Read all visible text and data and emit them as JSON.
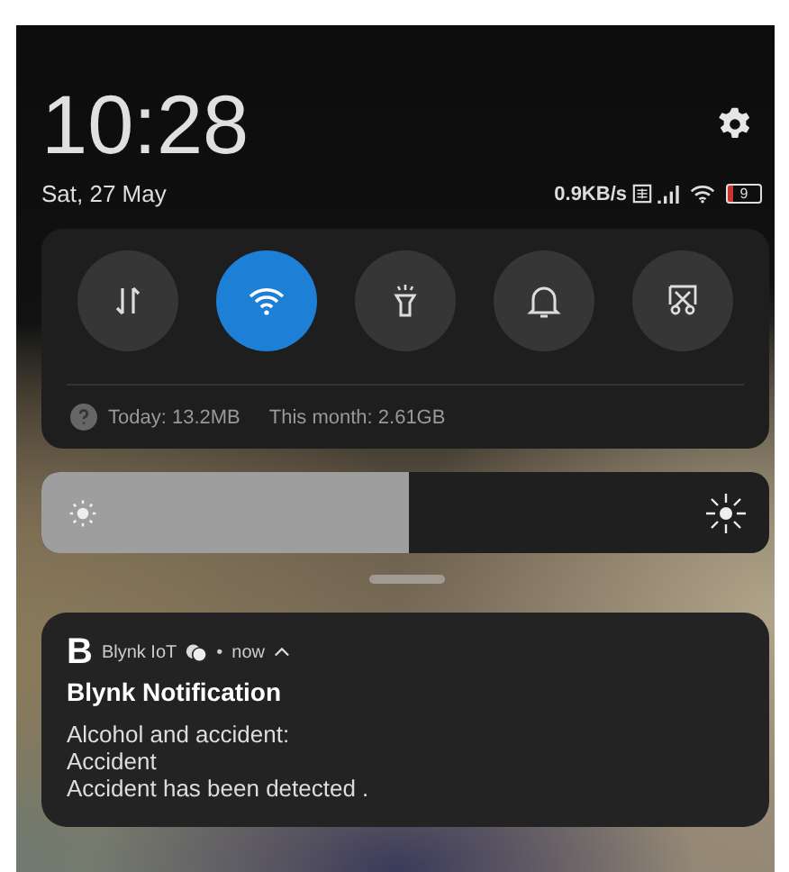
{
  "clock": {
    "time": "10:28",
    "date": "Sat, 27 May"
  },
  "status_bar": {
    "net_speed": "0.9KB/s",
    "battery": "9"
  },
  "toggles": [
    {
      "kind": "data",
      "on": false
    },
    {
      "kind": "wifi",
      "on": true
    },
    {
      "kind": "flashlight",
      "on": false
    },
    {
      "kind": "sound",
      "on": false
    },
    {
      "kind": "screenshot",
      "on": false
    }
  ],
  "data_usage": {
    "today": "Today: 13.2MB",
    "month": "This month: 2.61GB"
  },
  "brightness": {
    "level": 0.505
  },
  "notification": {
    "app_logo": "B",
    "app": "Blynk IoT",
    "separator": "•",
    "time": "now",
    "expanded": true,
    "title": "Blynk Notification",
    "lines": [
      "Alcohol and accident:",
      "Accident",
      "Accident has been detected ."
    ]
  }
}
